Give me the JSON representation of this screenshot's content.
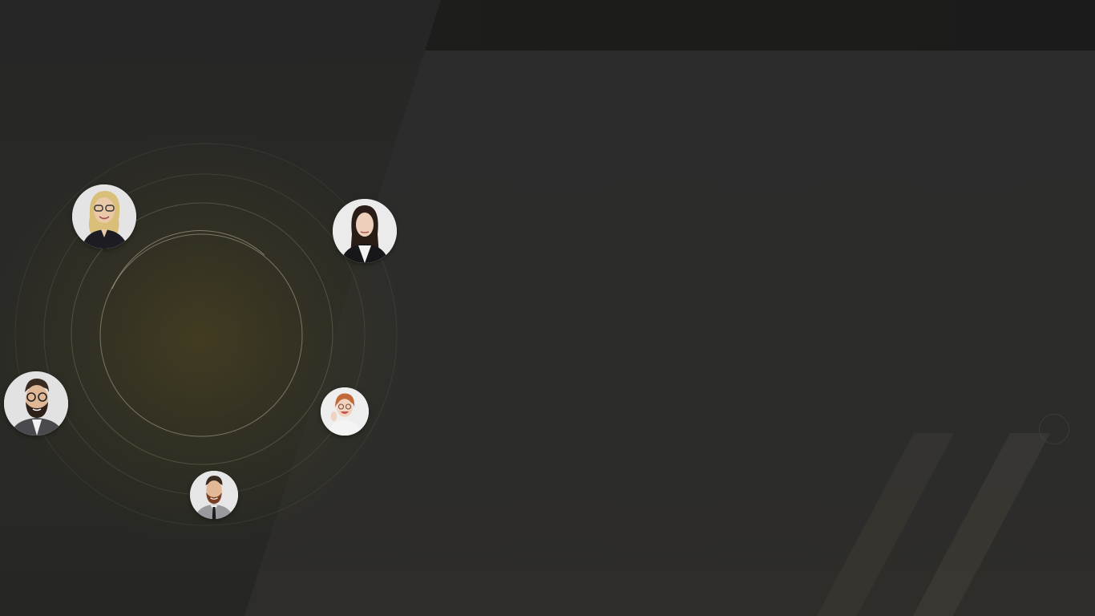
{
  "avatars": [
    {
      "name": "avatar-woman-blonde-glasses",
      "skin": "#e9c9a8",
      "hair": "#d9bf7a",
      "clothes": "#1c1c22",
      "bg": "#e4e4e4"
    },
    {
      "name": "avatar-woman-dark-hair",
      "skin": "#ecd0bc",
      "hair": "#2a1d18",
      "clothes": "#17171a",
      "bg": "#ebebeb"
    },
    {
      "name": "avatar-man-beard-glasses",
      "skin": "#e1b896",
      "hair": "#3a2a20",
      "clothes": "#4a4a4e",
      "bg": "#e2e2e2"
    },
    {
      "name": "avatar-woman-redhead",
      "skin": "#f0d2bf",
      "hair": "#c2693a",
      "clothes": "#f4f4f4",
      "bg": "#eeeeee"
    },
    {
      "name": "avatar-man-beard-tie",
      "skin": "#e2b896",
      "hair": "#3a2a20",
      "clothes": "#9a9a9e",
      "bg": "#e6e6e6"
    }
  ],
  "colors": {
    "background": "#2a2a2a",
    "top_bar": "#1b1b1b",
    "glow": "#544a1c",
    "ring": "#8a8770"
  }
}
